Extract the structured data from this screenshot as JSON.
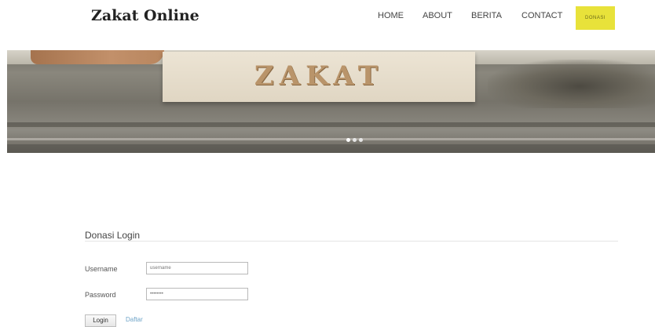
{
  "header": {
    "brand": "Zakat Online",
    "nav": [
      {
        "label": "HOME"
      },
      {
        "label": "ABOUT"
      },
      {
        "label": "BERITA"
      },
      {
        "label": "CONTACT"
      }
    ],
    "donasi_label": "DONASI"
  },
  "hero": {
    "sign_text": "ZAKAT",
    "slide_count": 3,
    "active_slide": 1
  },
  "login": {
    "title": "Donasi Login",
    "username_label": "Username",
    "username_placeholder": "username",
    "password_label": "Password",
    "password_placeholder": "••••••••",
    "login_button": "Login",
    "register_link": "Daftar"
  },
  "colors": {
    "donasi_bg": "#e8e23a",
    "link": "#6fa4c8"
  }
}
